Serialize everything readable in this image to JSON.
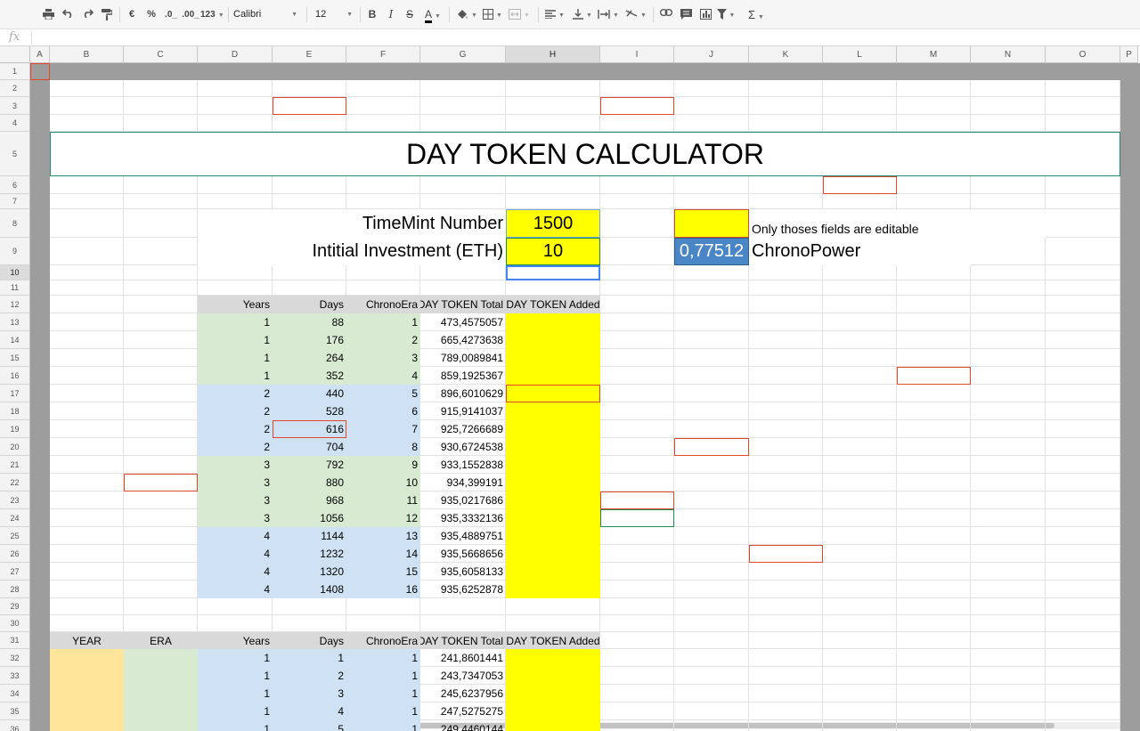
{
  "toolbar": {
    "currency": "€",
    "percent": "%",
    "dec_less": ".0_",
    "dec_more": ".00_",
    "format_more": "123",
    "font": "Calibri",
    "font_size": "12",
    "bold": "B",
    "italic": "I",
    "strike": "S",
    "text_color": "A",
    "sum": "Σ"
  },
  "formula_bar": {
    "icon": "fx",
    "value": ""
  },
  "columns": [
    "A",
    "B",
    "C",
    "D",
    "E",
    "F",
    "G",
    "H",
    "I",
    "J",
    "K",
    "L",
    "M",
    "N",
    "O",
    "P"
  ],
  "rows": [
    "1",
    "2",
    "3",
    "4",
    "5",
    "6",
    "7",
    "8",
    "9",
    "10",
    "11",
    "12",
    "13",
    "14",
    "15",
    "16",
    "17",
    "18",
    "19",
    "20",
    "21",
    "22",
    "23",
    "24",
    "25",
    "26",
    "27",
    "28",
    "29",
    "30",
    "31",
    "32",
    "33",
    "34",
    "35",
    "36"
  ],
  "sheet": {
    "title": "DAY TOKEN CALCULATOR",
    "timemint_label": "TimeMint Number",
    "timemint_value": "1500",
    "investment_label": "Intitial Investment (ETH)",
    "investment_value": "10",
    "note": "Only thoses fields are editable",
    "chronopower_value": "0,77512",
    "chronopower_label": "ChronoPower"
  },
  "table1": {
    "headers": [
      "Years",
      "Days",
      "ChronoEra",
      "DAY TOKEN Total",
      "DAY TOKEN Added"
    ],
    "rows": [
      [
        "1",
        "88",
        "1",
        "473,4575057"
      ],
      [
        "1",
        "176",
        "2",
        "665,4273638"
      ],
      [
        "1",
        "264",
        "3",
        "789,0089841"
      ],
      [
        "1",
        "352",
        "4",
        "859,1925367"
      ],
      [
        "2",
        "440",
        "5",
        "896,6010629"
      ],
      [
        "2",
        "528",
        "6",
        "915,9141037"
      ],
      [
        "2",
        "616",
        "7",
        "925,7266689"
      ],
      [
        "2",
        "704",
        "8",
        "930,6724538"
      ],
      [
        "3",
        "792",
        "9",
        "933,1552838"
      ],
      [
        "3",
        "880",
        "10",
        "934,399191"
      ],
      [
        "3",
        "968",
        "11",
        "935,0217686"
      ],
      [
        "3",
        "1056",
        "12",
        "935,3332136"
      ],
      [
        "4",
        "1144",
        "13",
        "935,4889751"
      ],
      [
        "4",
        "1232",
        "14",
        "935,5668656"
      ],
      [
        "4",
        "1320",
        "15",
        "935,6058133"
      ],
      [
        "4",
        "1408",
        "16",
        "935,6252878"
      ]
    ]
  },
  "table2": {
    "year_header": "YEAR",
    "era_header": "ERA",
    "headers": [
      "Years",
      "Days",
      "ChronoEra",
      "DAY TOKEN Total",
      "DAY TOKEN Added"
    ],
    "rows": [
      [
        "1",
        "1",
        "1",
        "241,8601441"
      ],
      [
        "1",
        "2",
        "1",
        "243,7347053"
      ],
      [
        "1",
        "3",
        "1",
        "245,6237956"
      ],
      [
        "1",
        "4",
        "1",
        "247,5275275"
      ],
      [
        "1",
        "5",
        "1",
        "249,4460144"
      ]
    ]
  },
  "colors": {
    "header_gray": "#d9d9d9",
    "green": "#d9ead3",
    "blue": "#cfe2f3",
    "yellow": "#ffff00",
    "year_fill": "#ffe599",
    "chrono_fill": "#4a86c5",
    "red_border": "#e0462a"
  }
}
